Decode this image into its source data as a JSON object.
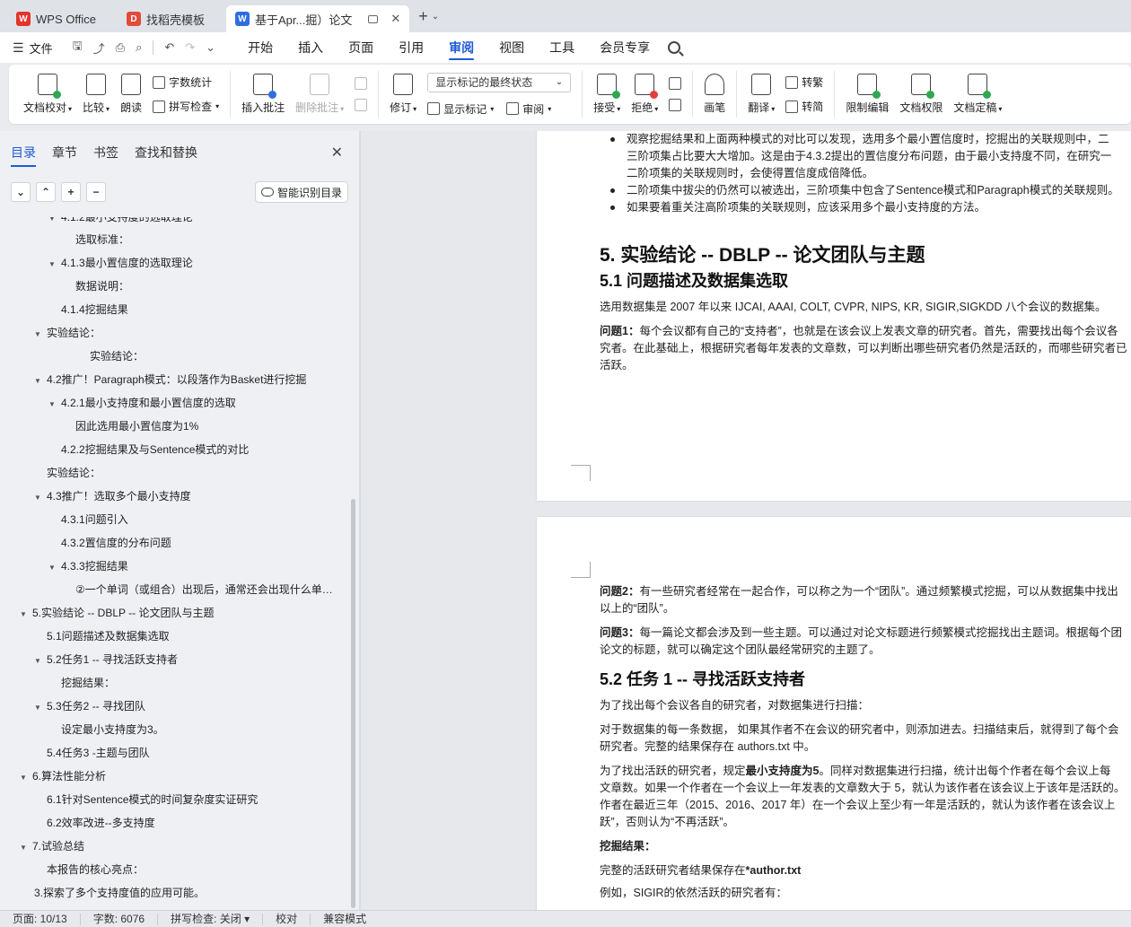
{
  "tabs": [
    {
      "label": "WPS Office",
      "logo": "W",
      "color": "#e2352b"
    },
    {
      "label": "找稻壳模板",
      "logo": "D",
      "color": "#e24a3a"
    },
    {
      "label": "基于Apr...掘）论文",
      "logo": "W",
      "color": "#2f6de0"
    }
  ],
  "menubar": {
    "file": "文件",
    "menus": [
      "开始",
      "插入",
      "页面",
      "引用",
      "审阅",
      "视图",
      "工具",
      "会员专享"
    ],
    "active_menu": "审阅"
  },
  "ribbon": {
    "doc_check": "文档校对",
    "compare": "比较",
    "read": "朗读",
    "word_count": "字数统计",
    "spell_check": "拼写检查",
    "insert_comment": "插入批注",
    "delete_comment": "删除批注",
    "revise": "修订",
    "markup_dropdown": "显示标记的最终状态",
    "show_markup": "显示标记",
    "review": "审阅",
    "accept": "接受",
    "reject": "拒绝",
    "pen": "画笔",
    "translate": "翻译",
    "to_traditional": "转繁",
    "to_simplified": "转简",
    "restrict_edit": "限制编辑",
    "doc_permission": "文档权限",
    "doc_finalize": "文档定稿"
  },
  "nav": {
    "tabs": [
      "目录",
      "章节",
      "书签",
      "查找和替换"
    ],
    "smart_toc": "智能识别目录",
    "items": [
      {
        "label": "4.1.2最小支持度的选取理论",
        "level": 2,
        "arrow": true,
        "clip": true
      },
      {
        "label": "选取标准：",
        "level": 3,
        "arrow": false
      },
      {
        "label": "4.1.3最小置信度的选取理论",
        "level": 2,
        "arrow": true
      },
      {
        "label": "数据说明：",
        "level": 3,
        "arrow": false
      },
      {
        "label": "4.1.4挖掘结果",
        "level": 2,
        "arrow": false
      },
      {
        "label": "实验结论：",
        "level": 1,
        "arrow": true
      },
      {
        "label": "实验结论：",
        "level": 4,
        "arrow": false
      },
      {
        "label": "4.2推广！Paragraph模式：以段落作为Basket进行挖掘",
        "level": 1,
        "arrow": true
      },
      {
        "label": "4.2.1最小支持度和最小置信度的选取",
        "level": 2,
        "arrow": true
      },
      {
        "label": "因此选用最小置信度为1%",
        "level": 3,
        "arrow": false
      },
      {
        "label": "4.2.2挖掘结果及与Sentence模式的对比",
        "level": 2,
        "arrow": false
      },
      {
        "label": "实验结论：",
        "level": 1,
        "arrow": false
      },
      {
        "label": "4.3推广！选取多个最小支持度",
        "level": 1,
        "arrow": true
      },
      {
        "label": "4.3.1问题引入",
        "level": 2,
        "arrow": false
      },
      {
        "label": "4.3.2置信度的分布问题",
        "level": 2,
        "arrow": false
      },
      {
        "label": "4.3.3挖掘结果",
        "level": 2,
        "arrow": true
      },
      {
        "label": "②一个单词（或组合）出现后，通常还会出现什么单词？",
        "level": 3,
        "arrow": false
      },
      {
        "label": "5.实验结论 -- DBLP -- 论文团队与主题",
        "level": 0,
        "arrow": true
      },
      {
        "label": "5.1问题描述及数据集选取",
        "level": 1,
        "arrow": false
      },
      {
        "label": "5.2任务1 -- 寻找活跃支持者",
        "level": 1,
        "arrow": true
      },
      {
        "label": "挖掘结果：",
        "level": 2,
        "arrow": false
      },
      {
        "label": "5.3任务2 -- 寻找团队",
        "level": 1,
        "arrow": true
      },
      {
        "label": "设定最小支持度为3。",
        "level": 2,
        "arrow": false
      },
      {
        "label": "5.4任务3 -主题与团队",
        "level": 1,
        "arrow": false
      },
      {
        "label": "6.算法性能分析",
        "level": 0,
        "arrow": true
      },
      {
        "label": "6.1针对Sentence模式的时间复杂度实证研究",
        "level": 1,
        "arrow": false
      },
      {
        "label": "6.2效率改进--多支持度",
        "level": 1,
        "arrow": false
      },
      {
        "label": "7.试验总结",
        "level": 0,
        "arrow": true
      },
      {
        "label": "本报告的核心亮点：",
        "level": 1,
        "arrow": false
      },
      {
        "label": "3.探索了多个支持度值的应用可能。",
        "level": 0,
        "arrow": false,
        "noarrowpad": true
      }
    ]
  },
  "doc": {
    "page1": {
      "bullets": [
        "观察挖掘结果和上面两种模式的对比可以发现，选用多个最小置信度时，挖掘出的关联规则中，二",
        "三阶项集占比要大大增加。这是由于4.3.2提出的置信度分布问题，由于最小支持度不同，在研究一",
        "二阶项集的关联规则时，会使得置信度成倍降低。",
        "二阶项集中拔尖的仍然可以被选出，三阶项集中包含了Sentence模式和Paragraph模式的关联规则。",
        "如果要着重关注高阶项集的关联规则，应该采用多个最小支持度的方法。"
      ],
      "h1": "5. 实验结论 -- DBLP -- 论文团队与主题",
      "h2": "5.1 问题描述及数据集选取",
      "p1": "选用数据集是 2007 年以来 IJCAI, AAAI, COLT, CVPR, NIPS, KR, SIGIR,SIGKDD 八个会议的数据集。",
      "q1_label": "问题1：",
      "q1_lines": [
        "每个会议都有自己的“支持者”，也就是在该会议上发表文章的研究者。首先，需要找出每个会议各",
        "究者。在此基础上，根据研究者每年发表的文章数，可以判断出哪些研究者仍然是活跃的，而哪些研究者已",
        "活跃。"
      ]
    },
    "page2": {
      "q2_label": "问题2：",
      "q2_lines": [
        "有一些研究者经常在一起合作，可以称之为一个“团队”。通过频繁模式挖掘，可以从数据集中找出",
        "以上的“团队”。"
      ],
      "q3_label": "问题3：",
      "q3_lines": [
        "每一篇论文都会涉及到一些主题。可以通过对论文标题进行频繁模式挖掘找出主题词。根据每个团",
        "论文的标题，就可以确定这个团队最经常研究的主题了。"
      ],
      "h2": "5.2 任务 1 -- 寻找活跃支持者",
      "p1": "为了找出每个会议各自的研究者，对数据集进行扫描：",
      "p2_lines": [
        "对于数据集的每一条数据，  如果其作者不在会议的研究者中，则添加进去。扫描结束后，就得到了每个会",
        "研究者。完整的结果保存在 authors.txt 中。"
      ],
      "p3_pre": "为了找出活跃的研究者，规定",
      "p3_bold": "最小支持度为5",
      "p3_post": "。同样对数据集进行扫描，统计出每个作者在每个会议上每",
      "p3_lines": [
        "文章数。如果一个作者在一个会议上一年发表的文章数大于  5，就认为该作者在该会议上于该年是活跃的。",
        "作者在最近三年（2015、2016、2017   年）在一个会议上至少有一年是活跃的，就认为该作者在该会议上",
        "跃”，否则认为“不再活跃”。"
      ],
      "mining_label": "挖掘结果：",
      "result_pre": "完整的活跃研究者结果保存在",
      "result_file": "*author.txt",
      "cut_line": "例如，SIGIR的依然活跃的研究者有："
    }
  },
  "status": {
    "page": "页面: 10/13",
    "words": "字数: 6076",
    "spell": "拼写检查: 关闭",
    "proof": "校对",
    "compat": "兼容模式"
  }
}
